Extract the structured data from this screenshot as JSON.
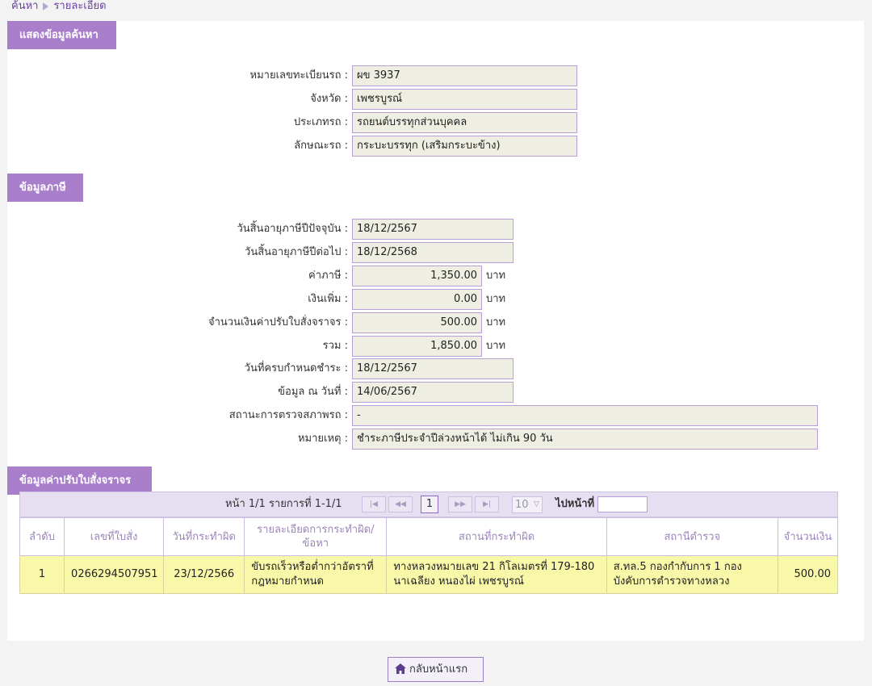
{
  "breadcrumb": {
    "home": "ค้นหา",
    "current": "รายละเอียด"
  },
  "search_section": {
    "title": "แสดงข้อมูลค้นหา",
    "fields": [
      {
        "label": "หมายเลขทะเบียนรถ :",
        "value": "ผข 3937"
      },
      {
        "label": "จังหวัด :",
        "value": "เพชรบูรณ์"
      },
      {
        "label": "ประเภทรถ :",
        "value": "รถยนต์บรรทุกส่วนบุคคล"
      },
      {
        "label": "ลักษณะรถ :",
        "value": "กระบะบรรทุก (เสริมกระบะข้าง)"
      }
    ]
  },
  "tax_section": {
    "title": "ข้อมูลภาษี",
    "current_expiry": {
      "label": "วันสิ้นอายุภาษีปีปัจจุบัน :",
      "value": "18/12/2567"
    },
    "next_expiry": {
      "label": "วันสิ้นอายุภาษีปีต่อไป :",
      "value": "18/12/2568"
    },
    "tax": {
      "label": "ค่าภาษี :",
      "value": "1,350.00",
      "unit": "บาท"
    },
    "surcharge": {
      "label": "เงินเพิ่ม :",
      "value": "0.00",
      "unit": "บาท"
    },
    "fine_amount": {
      "label": "จำนวนเงินค่าปรับใบสั่งจราจร :",
      "value": "500.00",
      "unit": "บาท"
    },
    "total": {
      "label": "รวม :",
      "value": "1,850.00",
      "unit": "บาท"
    },
    "due_date": {
      "label": "วันที่ครบกำหนดชำระ :",
      "value": "18/12/2567"
    },
    "data_as_of": {
      "label": "ข้อมูล ณ วันที่ :",
      "value": "14/06/2567"
    },
    "inspection_station": {
      "label": "สถานะการตรวจสภาพรถ :",
      "value": "-"
    },
    "remark": {
      "label": "หมายเหตุ :",
      "value": "ชำระภาษีประจำปีล่วงหน้าได้ ไม่เกิน 90 วัน"
    }
  },
  "fine_section": {
    "title": "ข้อมูลค่าปรับใบสั่งจราจร",
    "pager": {
      "info": "หน้า 1/1 รายการที่ 1-1/1",
      "current_page": "1",
      "page_size": "10",
      "goto_label": "ไปหน้าที่",
      "goto_value": ""
    },
    "columns": [
      "ลำดับ",
      "เลขที่ใบสั่ง",
      "วันที่กระทำผิด",
      "รายละเอียดการกระทำผิด/ข้อหา",
      "สถานที่กระทำผิด",
      "สถานีตำรวจ",
      "จำนวนเงิน"
    ],
    "rows": [
      [
        "1",
        "0266294507951",
        "23/12/2566",
        "ขับรถเร็วหรือต่ำกว่าอัตราที่กฎหมายกำหนด",
        "ทางหลวงหมายเลข 21 กิโลเมตรที่ 179-180 นาเฉลียง หนองไผ่ เพชรบูรณ์",
        "ส.ทล.5 กองกำกับการ 1 กองบังคับการตำรวจทางหลวง",
        "500.00"
      ]
    ]
  },
  "home_button": {
    "label": "กลับหน้าแรก",
    "icon": "home-icon"
  },
  "colors": {
    "accent": "#a97fcc",
    "field_bg": "#efeee3",
    "row_bg": "#f9f7a8",
    "pager_bg": "#e6dff2"
  }
}
